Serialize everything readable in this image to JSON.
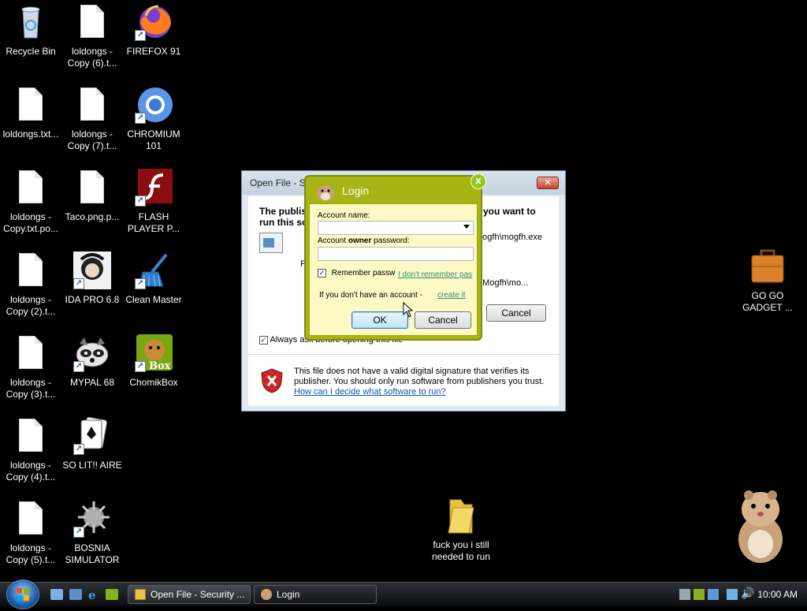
{
  "desktop_icons": [
    {
      "id": "recycle-bin",
      "label": "Recycle Bin"
    },
    {
      "id": "loldongs-6",
      "label": "loldongs - Copy (6).t..."
    },
    {
      "id": "firefox",
      "label": "FIREFOX 91"
    },
    {
      "id": "loldongs-txt",
      "label": "loldongs.txt..."
    },
    {
      "id": "loldongs-7",
      "label": "loldongs - Copy (7).t..."
    },
    {
      "id": "chromium",
      "label": "CHROMIUM 101"
    },
    {
      "id": "loldongs-copy",
      "label": "loldongs - Copy.txt.po..."
    },
    {
      "id": "taco",
      "label": "Taco.png.p..."
    },
    {
      "id": "flash",
      "label": "FLASH PLAYER P..."
    },
    {
      "id": "loldongs-2",
      "label": "loldongs - Copy (2).t..."
    },
    {
      "id": "ida",
      "label": "IDA PRO 6.8"
    },
    {
      "id": "cleanmaster",
      "label": "Clean Master"
    },
    {
      "id": "loldongs-3",
      "label": "loldongs - Copy (3).t..."
    },
    {
      "id": "mypal",
      "label": "MYPAL 68"
    },
    {
      "id": "chomikbox",
      "label": "ChomikBox"
    },
    {
      "id": "loldongs-4",
      "label": "loldongs - Copy (4).t..."
    },
    {
      "id": "solitaire",
      "label": "SO LIT!! AIRE"
    },
    {
      "id": "loldongs-5",
      "label": "loldongs - Copy (5).t..."
    },
    {
      "id": "bosnia",
      "label": "BOSNIA SIMULATOR"
    },
    {
      "id": "folder",
      "label": "fuck you i still needed to run"
    },
    {
      "id": "gadget",
      "label": "GO GO GADGET ..."
    }
  ],
  "security_dialog": {
    "title": "Open File - Se",
    "heading_left": "The publis",
    "heading_left2": "run this so",
    "heading_right": "you want to",
    "path1": "mogfh\\mogfh.exe",
    "path2": "g\\Mogfh\\mo...",
    "partial_p": "P",
    "cancel_label": "Cancel",
    "always_ask": "Always ask before opening this file",
    "warning_text": "This file does not have a valid digital signature that verifies its publisher.  You should only run software from publishers you trust.",
    "help_link": "How can I decide what software to run?",
    "close_glyph": "✕"
  },
  "login_dialog": {
    "title": "Login",
    "account_name_label": "Account name:",
    "password_label_pre": "Account ",
    "password_label_bold": "owner",
    "password_label_post": " password:",
    "remember_label": "Remember passw",
    "forgot_link": "I don't remember pas",
    "no_account_text": "If you don't have an account -",
    "create_link": "create it",
    "ok_label": "OK",
    "cancel_label": "Cancel",
    "close_glyph": "x"
  },
  "taskbar": {
    "buttons": [
      {
        "label": "Open File - Security ..."
      },
      {
        "label": "Login"
      }
    ],
    "clock": "10:00 AM"
  },
  "colors": {
    "login_frame": "#a6b414",
    "login_body": "#fcf9c4",
    "link": "#0b56b4"
  }
}
